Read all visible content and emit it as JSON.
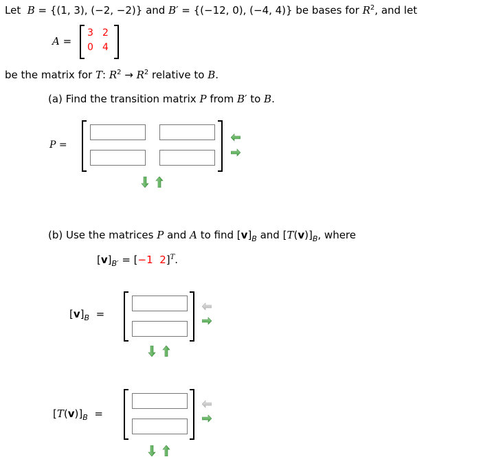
{
  "intro": {
    "let": "Let",
    "B": "B",
    "eq": " = ",
    "B_set": "{(1, 3), (−2, −2)}",
    "and": " and ",
    "Bp": "B′",
    "Bp_set": "{(−12, 0), (−4, 4)} be bases for ",
    "R": "R",
    "R_exp": "2",
    "tail": ",  and let"
  },
  "matrix_A": {
    "label": "A",
    "eq": " =",
    "values": [
      [
        "3",
        "2"
      ],
      [
        "0",
        "4"
      ]
    ]
  },
  "line2": {
    "pre": "be the matrix for ",
    "T": "T",
    "colon": ": ",
    "R1": "R",
    "exp1": "2",
    "arrow": " → ",
    "R2": "R",
    "exp2": "2",
    "post": " relative to ",
    "B": "B",
    "dot": "."
  },
  "part_a": {
    "pre": "(a) Find the transition matrix ",
    "P": "P",
    "mid": " from ",
    "Bp": "B′",
    "to": " to ",
    "B": "B",
    "dot": ".",
    "label_P": "P",
    "label_eq": " =",
    "inputs": [
      [
        "",
        ""
      ],
      [
        "",
        ""
      ]
    ]
  },
  "part_b": {
    "pre": "(b) Use the matrices ",
    "P": "P",
    "and1": " and ",
    "A": "A",
    "mid": " to find ",
    "vB_open": "[",
    "v": "v",
    "vB_close": "]",
    "subB": "B",
    "and2": " and ",
    "T_open": "[",
    "T": "T",
    "T_paren_open": "(",
    "T_v": "v",
    "T_paren_close": ")]",
    "subB2": "B",
    "where": ", where",
    "given": {
      "open": "[",
      "v": "v",
      "close": "]",
      "sub": "B′",
      "eq": " = [",
      "val1": "−1",
      "sp": "  ",
      "val2": "2",
      "close2": "]",
      "sup": "T",
      "dot": "."
    },
    "vB_label": {
      "open": "[",
      "v": "v",
      "close": "]",
      "sub": "B",
      "eq": "  ="
    },
    "TvB_label": {
      "open": "[",
      "T": "T",
      "p1": "(",
      "v": "v",
      "p2": ")]",
      "sub": "B",
      "eq": "  ="
    },
    "vB_inputs": [
      "",
      ""
    ],
    "TvB_inputs": [
      "",
      ""
    ]
  },
  "colors": {
    "given_values": "#ff0000",
    "arrow_active": "#5cb85c",
    "arrow_disabled": "#c8c8c8",
    "input_border": "#777777"
  },
  "icons": {
    "remove_column": "arrow-left-icon",
    "add_column": "arrow-right-icon",
    "add_row": "arrow-down-icon",
    "remove_row": "arrow-up-icon"
  }
}
